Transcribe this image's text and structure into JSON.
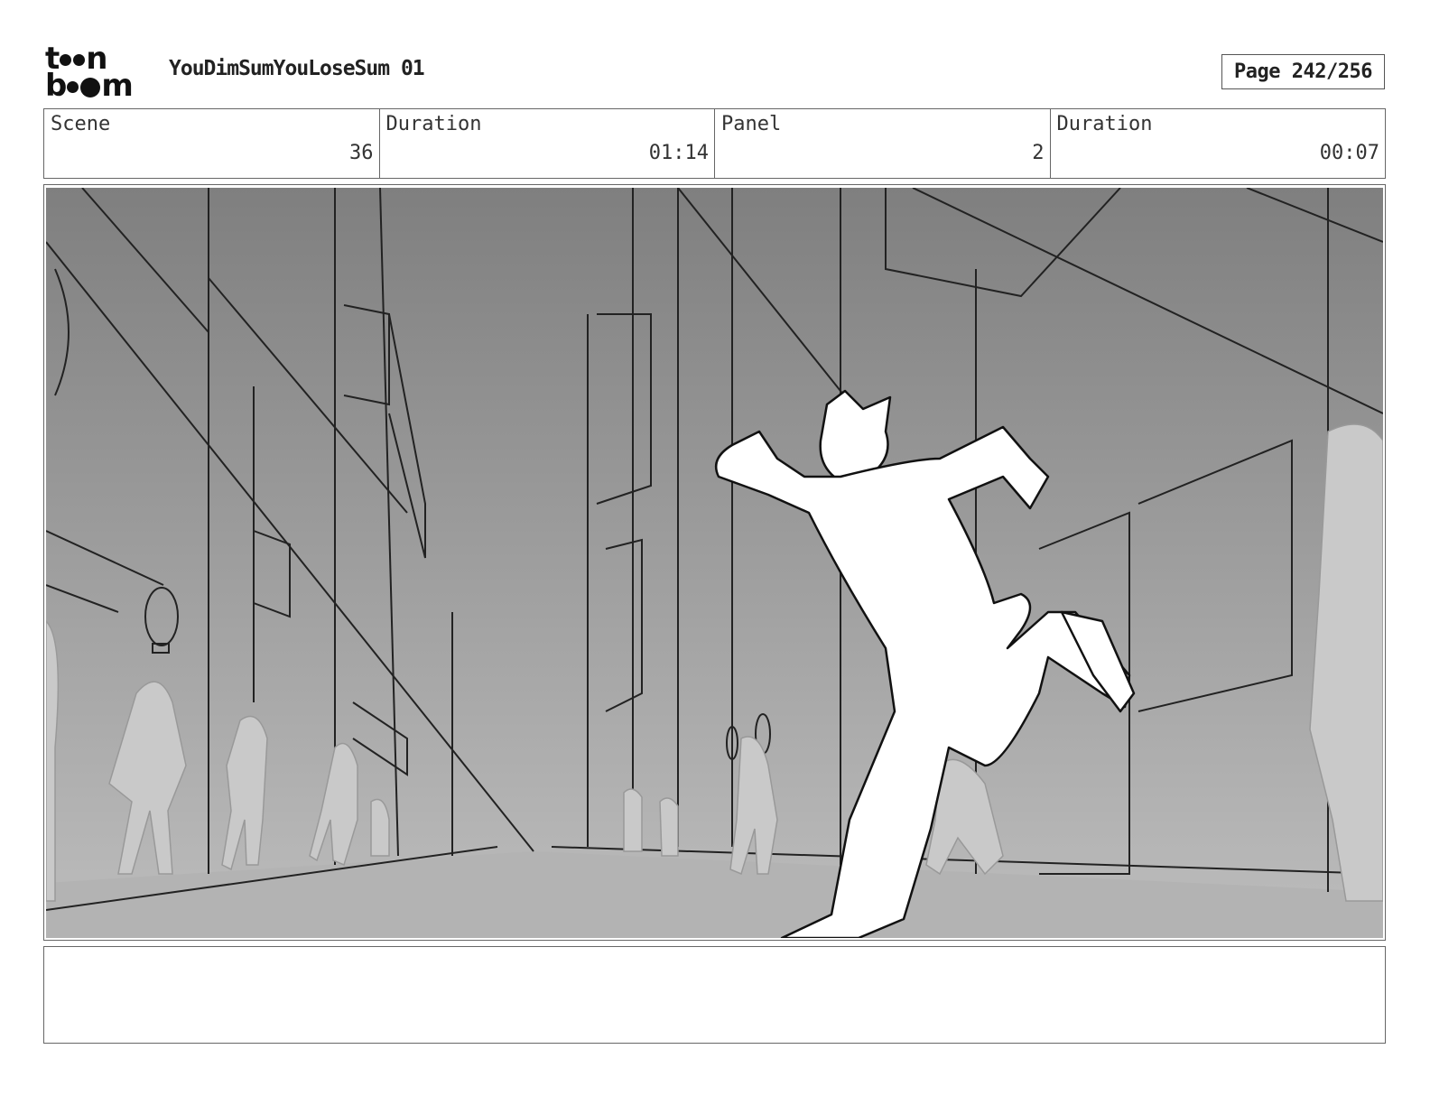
{
  "header": {
    "logo_line1": "t",
    "logo_line1b": "n",
    "logo_line2": "b",
    "logo_line2b": "m",
    "title": "YouDimSumYouLoseSum 01",
    "page": "Page 242/256"
  },
  "info": {
    "scene_label": "Scene",
    "scene_value": "36",
    "scene_duration_label": "Duration",
    "scene_duration_value": "01:14",
    "panel_label": "Panel",
    "panel_value": "2",
    "panel_duration_label": "Duration",
    "panel_duration_value": "00:07"
  },
  "panel": {
    "description": "",
    "colors": {
      "sky_top": "#7f7f7f",
      "sky_bottom": "#bdbdbd",
      "ground": "#b3b3b3",
      "figure": "#ffffff",
      "crowd": "#c9c9c9"
    }
  },
  "notes": {
    "text": ""
  }
}
